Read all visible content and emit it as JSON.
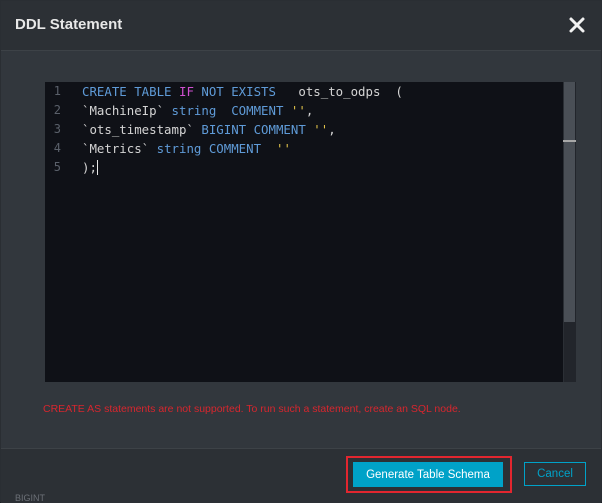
{
  "dialog": {
    "title": "DDL Statement",
    "close_icon": "close-icon"
  },
  "editor": {
    "line_numbers": [
      "1",
      "2",
      "3",
      "4",
      "5"
    ],
    "lines": [
      [
        {
          "t": "CREATE TABLE ",
          "c": "kw"
        },
        {
          "t": "IF ",
          "c": "kw2"
        },
        {
          "t": "NOT EXISTS",
          "c": "kw"
        },
        {
          "t": "   ots_to_odps  (",
          "c": ""
        }
      ],
      [
        {
          "t": "`MachineIp` ",
          "c": ""
        },
        {
          "t": "string",
          "c": "kw"
        },
        {
          "t": "  ",
          "c": ""
        },
        {
          "t": "COMMENT",
          "c": "kw"
        },
        {
          "t": " ",
          "c": ""
        },
        {
          "t": "''",
          "c": "str"
        },
        {
          "t": ",",
          "c": ""
        }
      ],
      [
        {
          "t": "`ots_timestamp` ",
          "c": ""
        },
        {
          "t": "BIGINT",
          "c": "kw"
        },
        {
          "t": " ",
          "c": ""
        },
        {
          "t": "COMMENT",
          "c": "kw"
        },
        {
          "t": " ",
          "c": ""
        },
        {
          "t": "''",
          "c": "str"
        },
        {
          "t": ",",
          "c": ""
        }
      ],
      [
        {
          "t": "`Metrics` ",
          "c": ""
        },
        {
          "t": "string",
          "c": "kw"
        },
        {
          "t": " ",
          "c": ""
        },
        {
          "t": "COMMENT",
          "c": "kw"
        },
        {
          "t": "  ",
          "c": ""
        },
        {
          "t": "''",
          "c": "str"
        }
      ],
      [
        {
          "t": ");",
          "c": ""
        }
      ]
    ]
  },
  "error": {
    "message": "CREATE AS statements are not supported. To run such a statement, create an SQL node."
  },
  "footer": {
    "generate_label": "Generate Table Schema",
    "cancel_label": "Cancel"
  },
  "background": {
    "peek_text": "BIGINT"
  },
  "colors": {
    "accent": "#00a2c8",
    "error": "#d7262e",
    "highlight": "#e2262f",
    "keyword": "#5f9bd8",
    "keyword_alt": "#cf4fd0",
    "string": "#e0c24a"
  }
}
